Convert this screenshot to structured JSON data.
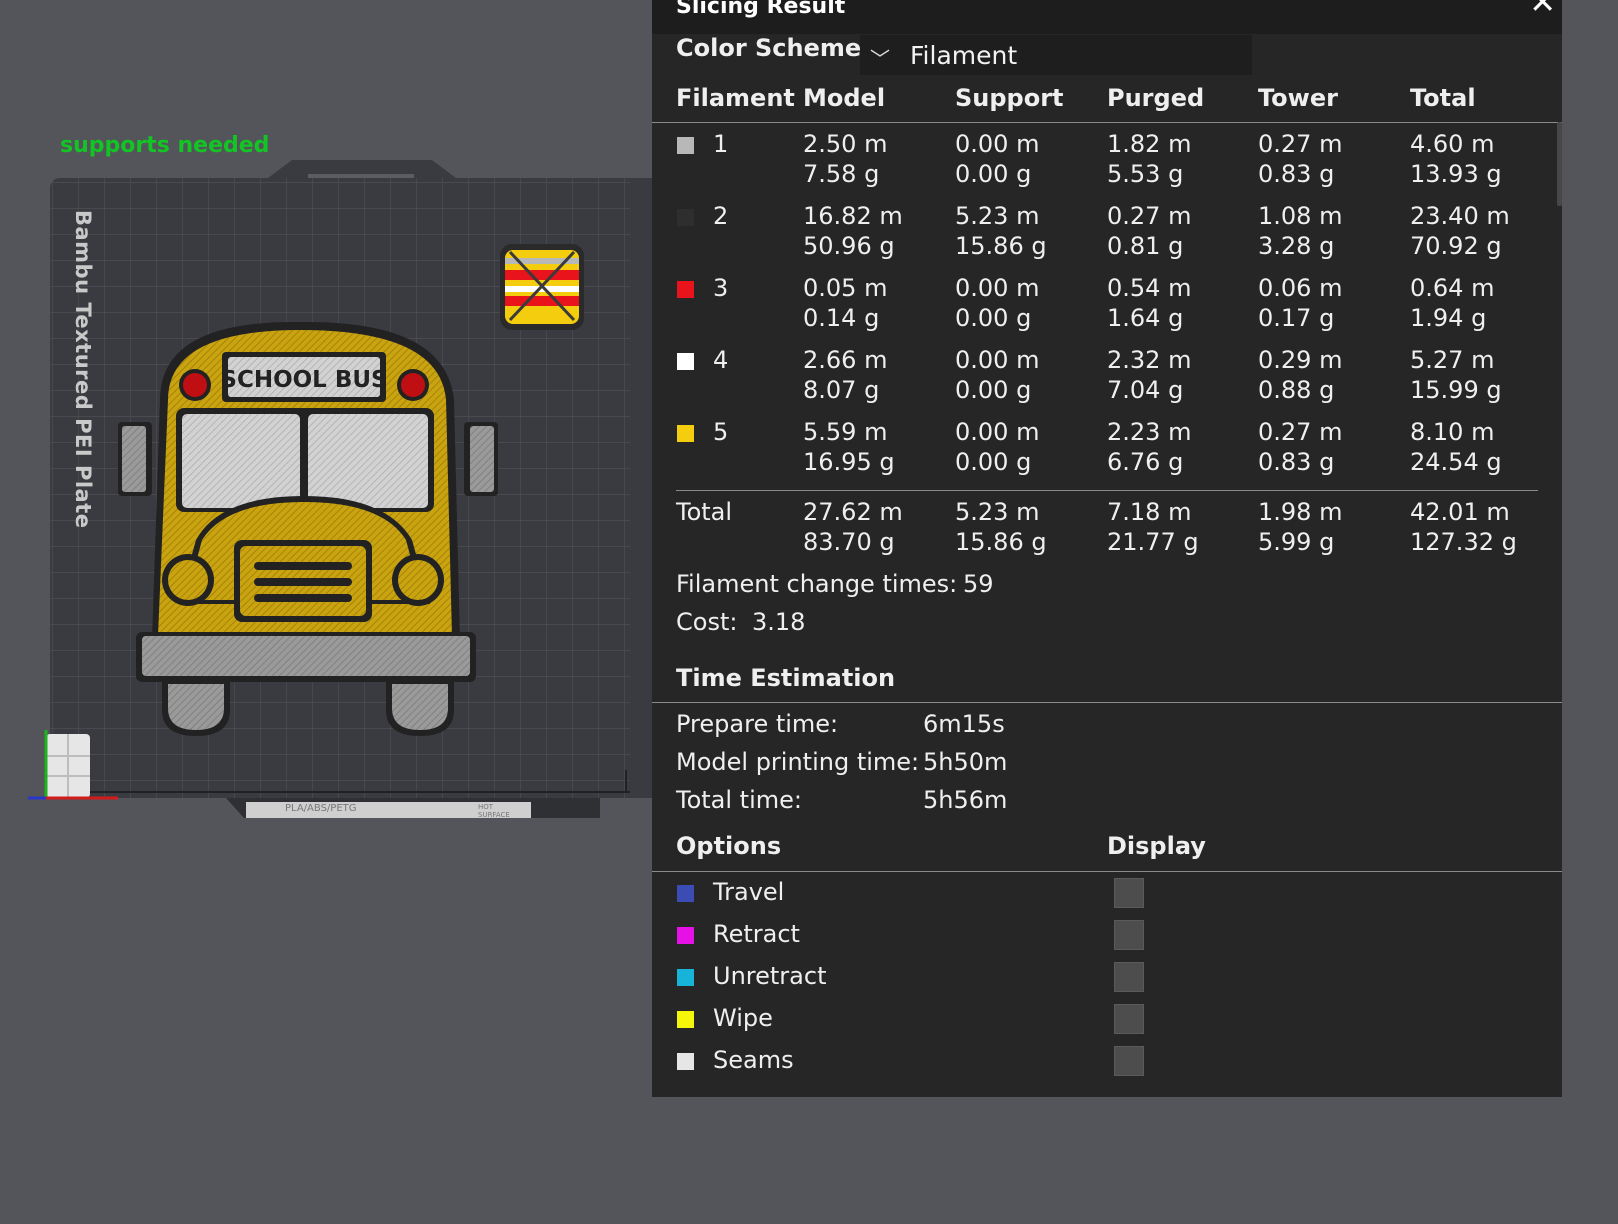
{
  "viewport": {
    "warning": "supports needed",
    "plate_label": "Bambu Textured PEI Plate",
    "bus_sign": "SCHOOL BUS",
    "plate_tag": "PLA/ABS/PETG",
    "plate_tag2": "HOT SURFACE"
  },
  "panel": {
    "title": "Slicing Result",
    "close_glyph": "✕",
    "color_scheme_label": "Color Scheme",
    "color_scheme_value": "Filament",
    "headers": [
      "Filament",
      "Model",
      "Support",
      "Purged",
      "Tower",
      "Total"
    ],
    "rows": [
      {
        "id": "1",
        "color": "#b8b8b8",
        "model": "2.50 m\n7.58 g",
        "support": "0.00 m\n0.00 g",
        "purged": "1.82 m\n5.53 g",
        "tower": "0.27 m\n0.83 g",
        "total": "4.60 m\n13.93 g"
      },
      {
        "id": "2",
        "color": "#2e2e2e",
        "model": "16.82 m\n50.96 g",
        "support": "5.23 m\n15.86 g",
        "purged": "0.27 m\n0.81 g",
        "tower": "1.08 m\n3.28 g",
        "total": "23.40 m\n70.92 g"
      },
      {
        "id": "3",
        "color": "#e8131b",
        "model": "0.05 m\n0.14 g",
        "support": "0.00 m\n0.00 g",
        "purged": "0.54 m\n1.64 g",
        "tower": "0.06 m\n0.17 g",
        "total": "0.64 m\n1.94 g"
      },
      {
        "id": "4",
        "color": "#ffffff",
        "model": "2.66 m\n8.07 g",
        "support": "0.00 m\n0.00 g",
        "purged": "2.32 m\n7.04 g",
        "tower": "0.29 m\n0.88 g",
        "total": "5.27 m\n15.99 g"
      },
      {
        "id": "5",
        "color": "#f3cd0e",
        "model": "5.59 m\n16.95 g",
        "support": "0.00 m\n0.00 g",
        "purged": "2.23 m\n6.76 g",
        "tower": "0.27 m\n0.83 g",
        "total": "8.10 m\n24.54 g"
      }
    ],
    "total_row": {
      "label": "Total",
      "model": "27.62 m\n83.70 g",
      "support": "5.23 m\n15.86 g",
      "purged": "7.18 m\n21.77 g",
      "tower": "1.98 m\n5.99 g",
      "total": "42.01 m\n127.32 g"
    },
    "filament_change_label": "Filament change times:",
    "filament_change_value": "59",
    "cost_label": "Cost:",
    "cost_value": "3.18",
    "time_title": "Time Estimation",
    "times": [
      {
        "label": "Prepare time:",
        "value": "6m15s"
      },
      {
        "label": "Model printing time:",
        "value": "5h50m"
      },
      {
        "label": "Total time:",
        "value": "5h56m"
      }
    ],
    "options_title": "Options",
    "display_title": "Display",
    "options": [
      {
        "label": "Travel",
        "color": "#3b4cb4"
      },
      {
        "label": "Retract",
        "color": "#e511e6"
      },
      {
        "label": "Unretract",
        "color": "#17b3d9"
      },
      {
        "label": "Wipe",
        "color": "#f6f60a"
      },
      {
        "label": "Seams",
        "color": "#e6e6e6"
      }
    ]
  }
}
